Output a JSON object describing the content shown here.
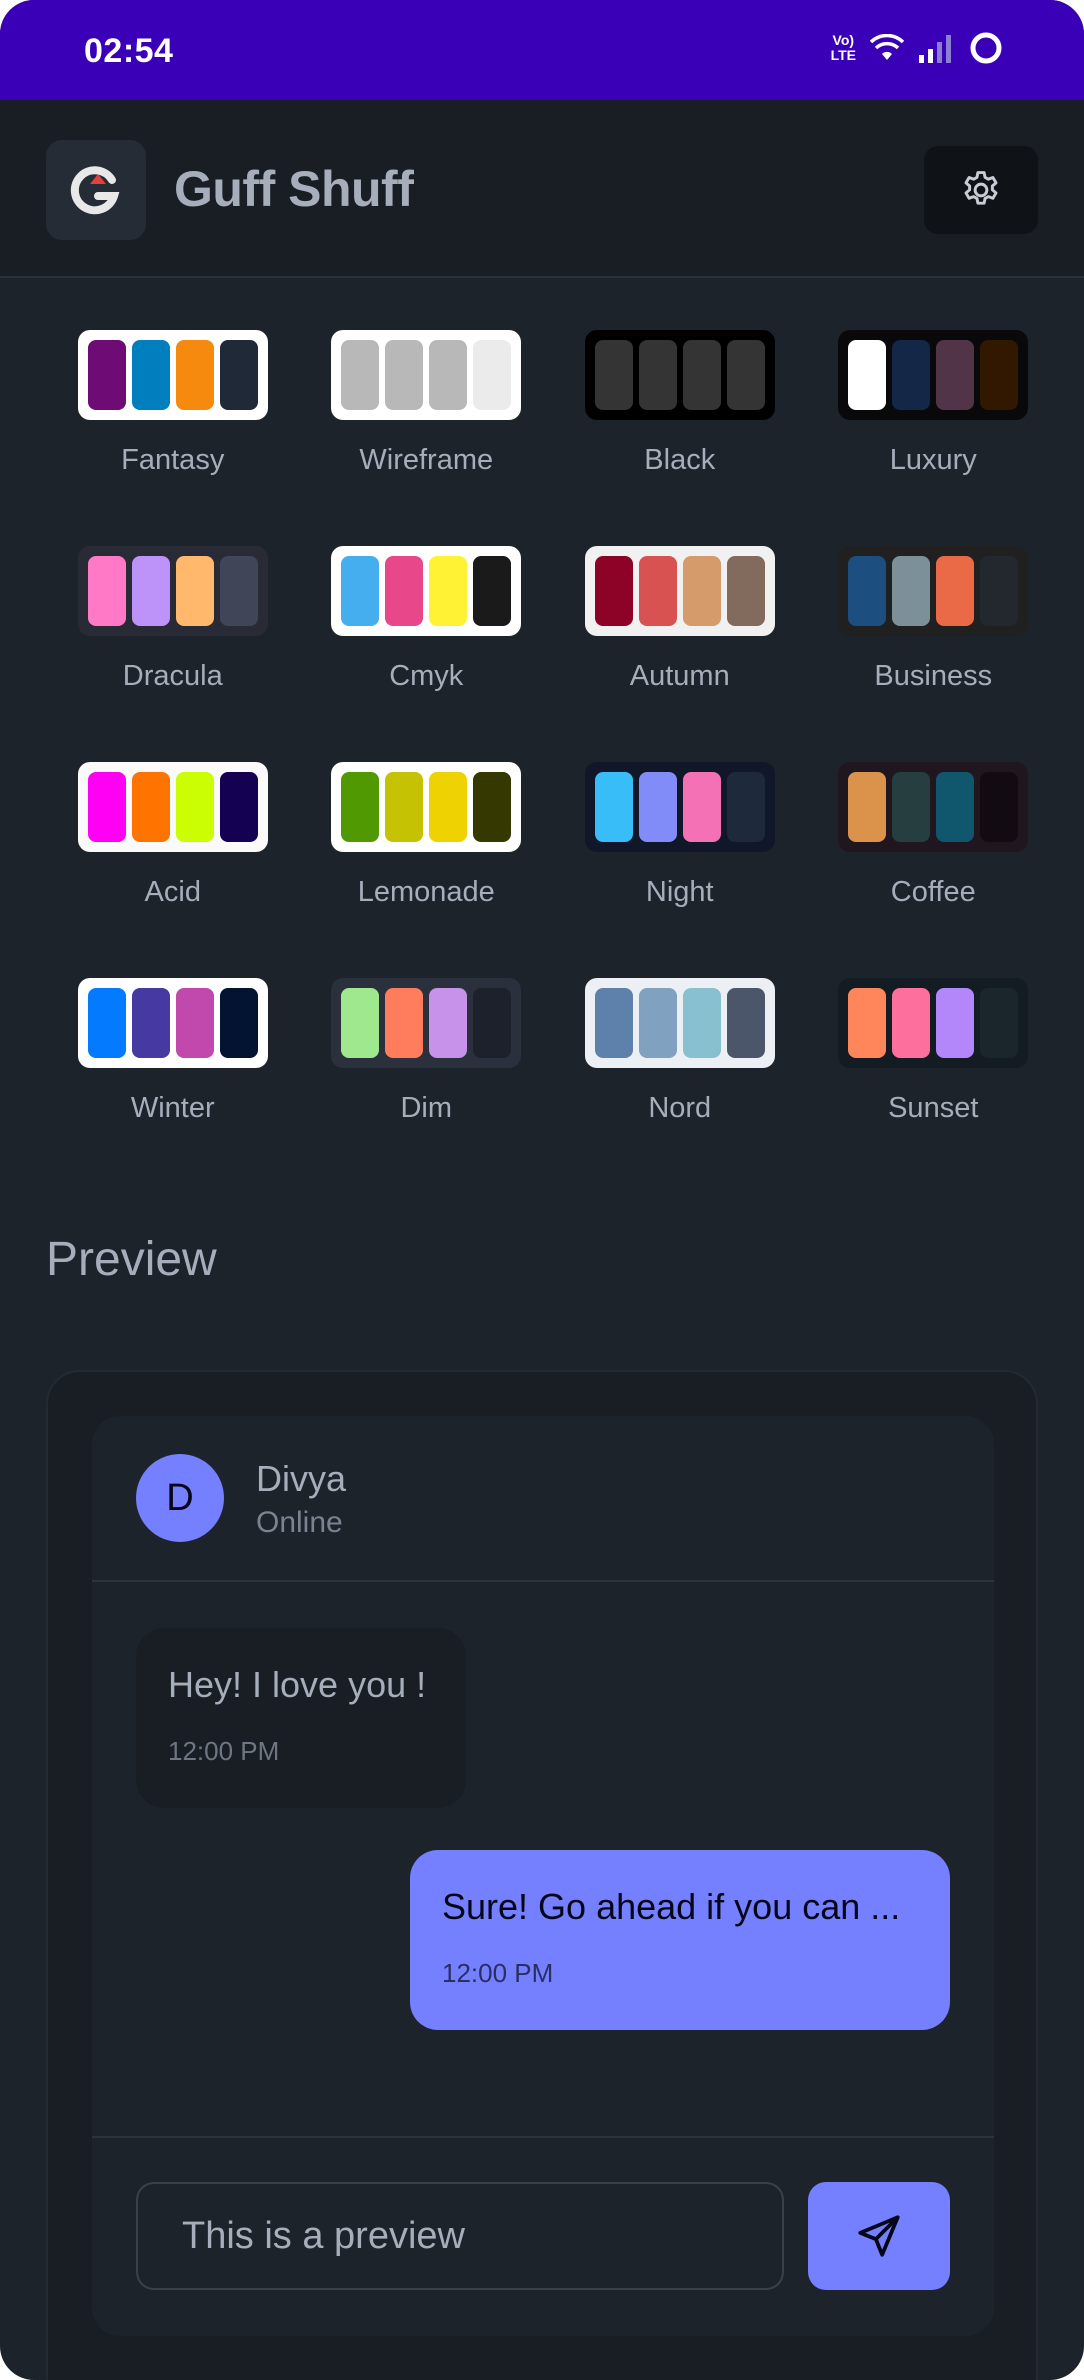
{
  "status_bar": {
    "time": "02:54",
    "volte_label": "Vo) LTE"
  },
  "app": {
    "title": "Guff Shuff",
    "logo_letter": "G"
  },
  "themes": [
    {
      "name": "Fantasy",
      "bg": "#ffffff",
      "colors": [
        "#6e0b75",
        "#007ebd",
        "#f68a0f",
        "#1f2937"
      ]
    },
    {
      "name": "Wireframe",
      "bg": "#ffffff",
      "colors": [
        "#b8b8b8",
        "#b8b8b8",
        "#b8b8b8",
        "#ebebeb"
      ]
    },
    {
      "name": "Black",
      "bg": "#000000",
      "colors": [
        "#343434",
        "#343434",
        "#343434",
        "#343434"
      ]
    },
    {
      "name": "Luxury",
      "bg": "#09090b",
      "colors": [
        "#ffffff",
        "#152747",
        "#513448",
        "#331800"
      ]
    },
    {
      "name": "Dracula",
      "bg": "#282a36",
      "colors": [
        "#ff79c6",
        "#bd93f9",
        "#ffb86c",
        "#414558"
      ]
    },
    {
      "name": "Cmyk",
      "bg": "#ffffff",
      "colors": [
        "#45aeee",
        "#e8488a",
        "#fff234",
        "#1a1a1a"
      ]
    },
    {
      "name": "Autumn",
      "bg": "#f1f1f1",
      "colors": [
        "#8c0327",
        "#d85251",
        "#d59b6a",
        "#826a5c"
      ]
    },
    {
      "name": "Business",
      "bg": "#202020",
      "colors": [
        "#1c4e80",
        "#7c909a",
        "#ea6947",
        "#23282e"
      ]
    },
    {
      "name": "Acid",
      "bg": "#fafafa",
      "colors": [
        "#ff00f4",
        "#ff7400",
        "#cbfd03",
        "#140152"
      ]
    },
    {
      "name": "Lemonade",
      "bg": "#ffffff",
      "colors": [
        "#519903",
        "#c4c203",
        "#eed202",
        "#353900"
      ]
    },
    {
      "name": "Night",
      "bg": "#0f1729",
      "colors": [
        "#38bdf8",
        "#818cf8",
        "#f471b5",
        "#1e293b"
      ]
    },
    {
      "name": "Coffee",
      "bg": "#20161f",
      "colors": [
        "#db924b",
        "#263e3f",
        "#10576d",
        "#120c12"
      ]
    },
    {
      "name": "Winter",
      "bg": "#ffffff",
      "colors": [
        "#047aff",
        "#463aa2",
        "#c148ac",
        "#021431"
      ]
    },
    {
      "name": "Dim",
      "bg": "#2a303c",
      "colors": [
        "#9fe88d",
        "#ff7d5c",
        "#c792e9",
        "#1c212b"
      ]
    },
    {
      "name": "Nord",
      "bg": "#eceff4",
      "colors": [
        "#5e81ac",
        "#81a1c1",
        "#88c0d0",
        "#4c566a"
      ]
    },
    {
      "name": "Sunset",
      "bg": "#121c22",
      "colors": [
        "#ff865b",
        "#fd6f9c",
        "#b387fa",
        "#1b262c"
      ]
    }
  ],
  "preview": {
    "title": "Preview",
    "contact": {
      "initial": "D",
      "name": "Divya",
      "status": "Online"
    },
    "messages": [
      {
        "text": "Hey! I love you !",
        "time": "12:00 PM",
        "direction": "incoming"
      },
      {
        "text": "Sure! Go ahead if you can ...",
        "time": "12:00 PM",
        "direction": "outgoing"
      }
    ],
    "input_value": "This is a preview"
  },
  "colors": {
    "status_bar": "#3a00b8",
    "accent": "#7480ff",
    "base": "#1d232a"
  },
  "icons": {
    "settings": "gear-icon",
    "send": "send-icon",
    "logo": "app-logo-icon"
  }
}
